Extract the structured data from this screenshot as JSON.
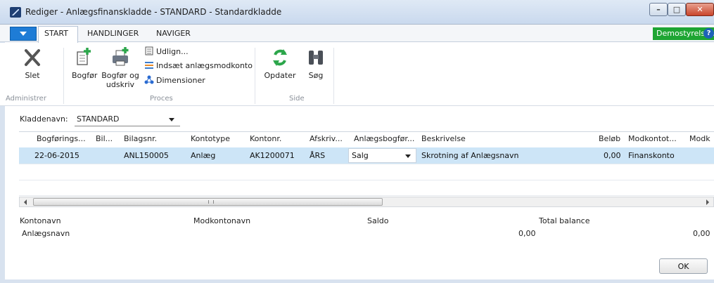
{
  "window": {
    "title": "Rediger - Anlægsfinanskladde - STANDARD - Standardkladde",
    "buttons": {
      "minimize": "–",
      "maximize": "□",
      "close": "✕"
    }
  },
  "ribbon": {
    "tabs": [
      "START",
      "HANDLINGER",
      "NAVIGER"
    ],
    "active_tab": "START",
    "company": "Demostyrelsen",
    "help": "?",
    "groups": {
      "administrer": {
        "label": "Administrer",
        "delete": "Slet"
      },
      "proces": {
        "label": "Proces",
        "post": "Bogfør",
        "post_print_line1": "Bogfør og",
        "post_print_line2": "udskriv",
        "apply": "Udlign...",
        "insert_balancing": "Indsæt anlægsmodkonto",
        "dimensions": "Dimensioner"
      },
      "side": {
        "label": "Side",
        "refresh": "Opdater",
        "search": "Søg"
      }
    }
  },
  "journal": {
    "label": "Kladdenavn:",
    "value": "STANDARD"
  },
  "grid": {
    "columns": [
      "Bogførings...",
      "Bil...",
      "Bilagsnr.",
      "Kontotype",
      "Kontonr.",
      "Afskriv...",
      "Anlægsbogfør...",
      "Beskrivelse",
      "Beløb",
      "Modkontot...",
      "Modk"
    ],
    "rows": [
      {
        "posting_date": "22-06-2015",
        "document_type": "",
        "document_no": "ANL150005",
        "account_type": "Anlæg",
        "account_no": "AK1200071",
        "depreciation_book": "ÅRS",
        "fa_posting_type": "Salg",
        "description": "Skrotning af Anlægsnavn",
        "amount": "0,00",
        "bal_account_type": "Finanskonto"
      }
    ],
    "scroll_marker": "III"
  },
  "footer": {
    "account_name_label": "Kontonavn",
    "account_name_value": "Anlægsnavn",
    "bal_account_name_label": "Modkontonavn",
    "balance_label": "Saldo",
    "balance_value": "0,00",
    "total_balance_label": "Total balance",
    "total_balance_value": "0,00"
  },
  "actions": {
    "ok": "OK"
  },
  "colors": {
    "selected_row": "#cde5f7",
    "company_badge": "#1ea533",
    "file_menu": "#1e7cd6"
  }
}
